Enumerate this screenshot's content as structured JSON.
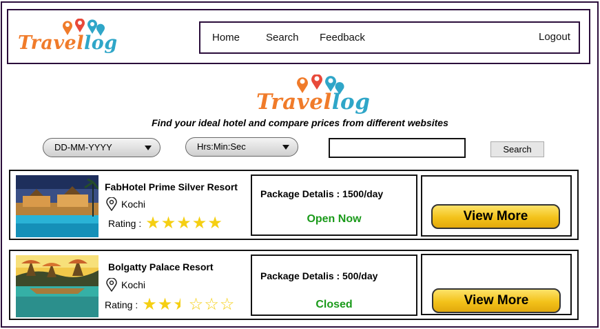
{
  "brand": {
    "logo_text_1": "Travel",
    "logo_text_2": "log"
  },
  "nav": {
    "items": [
      "Home",
      "Search",
      "Feedback"
    ],
    "logout": "Logout"
  },
  "tagline": "Find your ideal hotel and compare prices from different websites",
  "filters": {
    "date_placeholder": "DD-MM-YYYY",
    "time_placeholder": "Hrs:Min:Sec",
    "search_value": "",
    "search_button": "Search"
  },
  "results": [
    {
      "name": "FabHotel Prime Silver Resort",
      "location": "Kochi",
      "rating_label": "Rating :",
      "rating": 5,
      "package": "Package Detalis : 1500/day",
      "status": "Open Now",
      "action": "View More"
    },
    {
      "name": "Bolgatty Palace Resort",
      "location": "Kochi",
      "rating_label": "Rating :",
      "rating": 2.5,
      "package": "Package Detalis : 500/day",
      "status": "Closed",
      "action": "View More"
    }
  ],
  "colors": {
    "accent_orange": "#f07b2a",
    "accent_teal": "#2fa6c8",
    "status_green": "#1a9a1a",
    "star_yellow": "#f5cf12",
    "border_dark": "#2a0c3a"
  }
}
